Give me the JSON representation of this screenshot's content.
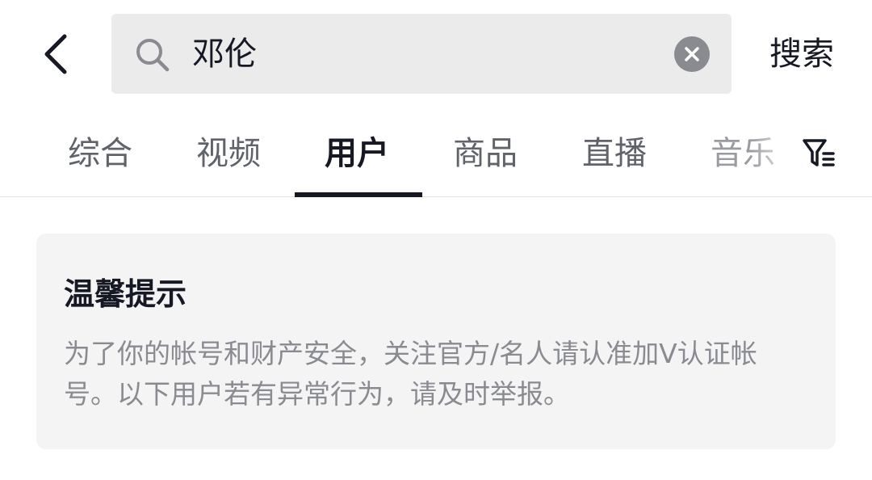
{
  "search": {
    "query": "邓伦",
    "submit_label": "搜索"
  },
  "tabs": [
    {
      "label": "综合"
    },
    {
      "label": "视频"
    },
    {
      "label": "用户"
    },
    {
      "label": "商品"
    },
    {
      "label": "直播"
    },
    {
      "label": "音乐"
    }
  ],
  "active_tab": "用户",
  "notice": {
    "title": "温馨提示",
    "body": "为了你的帐号和财产安全，关注官方/名人请认准加V认证帐号。以下用户若有异常行为，请及时举报。"
  },
  "icons": {
    "back": "back-arrow-icon",
    "search": "search-icon",
    "clear": "clear-icon",
    "filter": "filter-icon"
  },
  "colors": {
    "primary_text": "#161823",
    "secondary_text": "#61636b",
    "muted_text": "#8a8b91",
    "search_bg": "#ebebec",
    "card_bg": "#f4f4f5"
  }
}
